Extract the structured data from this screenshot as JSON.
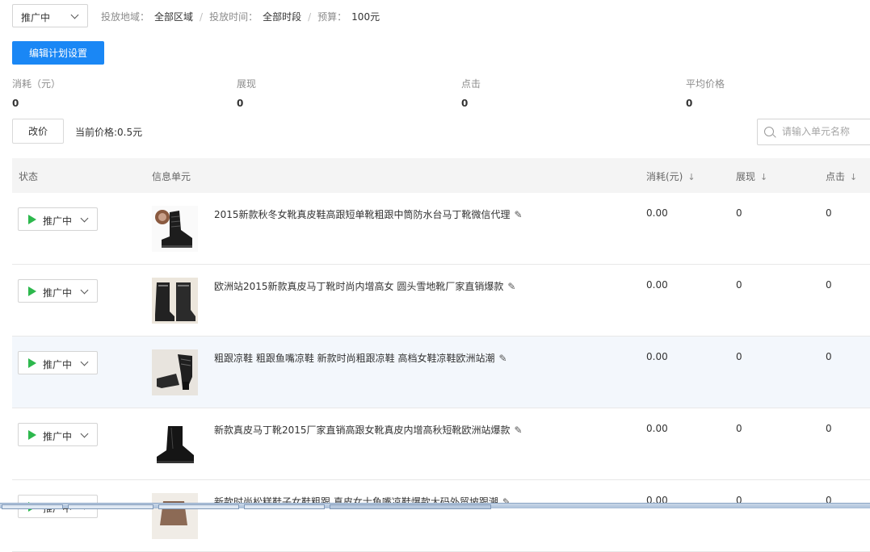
{
  "filter": {
    "status_label": "推广中",
    "region_label": "投放地域：",
    "region_value": "全部区域",
    "time_label": "投放时间：",
    "time_value": "全部时段",
    "budget_label": "预算：",
    "budget_value": "100元",
    "separator": "/"
  },
  "edit_plan_button": "编辑计划设置",
  "stats": [
    {
      "label": "消耗（元）",
      "value": "0"
    },
    {
      "label": "展现",
      "value": "0"
    },
    {
      "label": "点击",
      "value": "0"
    },
    {
      "label": "平均价格",
      "value": "0"
    }
  ],
  "price": {
    "button": "改价",
    "current": "当前价格:0.5元"
  },
  "search": {
    "placeholder": "请输入单元名称"
  },
  "table": {
    "headers": {
      "status": "状态",
      "unit": "信息单元",
      "cost": "消耗(元)",
      "impressions": "展现",
      "clicks": "点击"
    },
    "sort_arrow": "↓",
    "rows": [
      {
        "status": "推广中",
        "name": "2015新款秋冬女靴真皮鞋高跟短单靴粗跟中筒防水台马丁靴微信代理",
        "cost": "0.00",
        "impressions": "0",
        "clicks": "0"
      },
      {
        "status": "推广中",
        "name": "欧洲站2015新款真皮马丁靴时尚内增高女 圆头雪地靴厂家直销爆款",
        "cost": "0.00",
        "impressions": "0",
        "clicks": "0"
      },
      {
        "status": "推广中",
        "name": "粗跟凉鞋 粗跟鱼嘴凉鞋 新款时尚粗跟凉鞋 高档女鞋凉鞋欧洲站潮",
        "cost": "0.00",
        "impressions": "0",
        "clicks": "0"
      },
      {
        "status": "推广中",
        "name": "新款真皮马丁靴2015厂家直销高跟女靴真皮内增高秋短靴欧洲站爆款",
        "cost": "0.00",
        "impressions": "0",
        "clicks": "0"
      },
      {
        "status": "推广中",
        "name": "新款时尚松糕鞋子女鞋粗跟 真皮女士鱼嘴凉鞋爆款大码外贸坡跟潮",
        "cost": "0.00",
        "impressions": "0",
        "clicks": "0"
      }
    ]
  },
  "colors": {
    "primary": "#1a87f5",
    "status_green": "#2db84d",
    "header_bg": "#f4f4f4",
    "highlight_row": "#f3f7fc"
  }
}
